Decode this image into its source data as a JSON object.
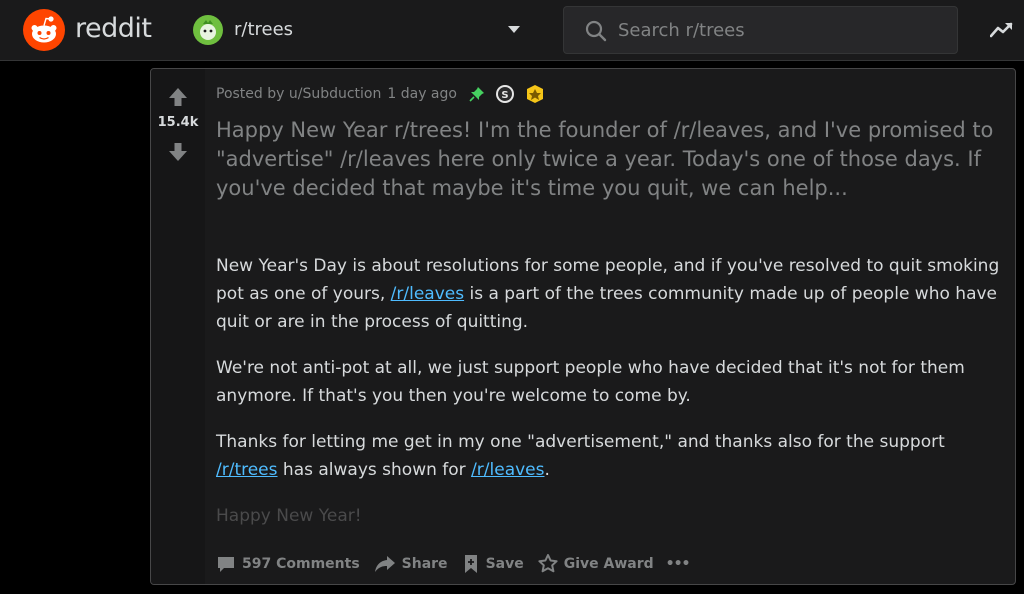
{
  "header": {
    "wordmark": "reddit",
    "subreddit": "r/trees",
    "search_placeholder": "Search r/trees"
  },
  "post": {
    "score": "15.4k",
    "posted_by_prefix": "Posted by u/Subduction",
    "time_ago": "1 day ago",
    "title": "Happy New Year r/trees! I'm the founder of /r/leaves, and I've promised to \"advertise\" /r/leaves here only twice a year. Today's one of those days. If you've decided that maybe it's time you quit, we can help...",
    "body": {
      "p1_before": "New Year's Day is about resolutions for some people, and if you've resolved to quit smoking pot as one of yours, ",
      "p1_link": "/r/leaves",
      "p1_after": " is a part of the trees community made up of people who have quit or are in the process of quitting.",
      "p2": "We're not anti-pot at all, we just support people who have decided that it's not for them anymore. If that's you then you're welcome to come by.",
      "p3_before": "Thanks for letting me get in my one \"advertisement,\" and thanks also for the support ",
      "p3_link1": "/r/trees",
      "p3_middle": " has always shown for ",
      "p3_link2": "/r/leaves",
      "p3_after": ".",
      "p4": "Happy New Year!"
    },
    "actions": {
      "comments": "597 Comments",
      "share": "Share",
      "save": "Save",
      "give_award": "Give Award",
      "more": "•••"
    }
  },
  "colors": {
    "accent": "#ff4500",
    "link": "#4fbcff",
    "pin": "#46d160",
    "award_gold": "#f5c518",
    "text_muted": "#818384"
  },
  "icons": [
    "reddit-logo-icon",
    "subreddit-icon",
    "chevron-down-icon",
    "search-icon",
    "trending-icon",
    "upvote-icon",
    "downvote-icon",
    "pin-icon",
    "silver-award-icon",
    "gold-award-icon",
    "comment-icon",
    "share-icon",
    "save-icon",
    "award-icon",
    "more-icon"
  ]
}
